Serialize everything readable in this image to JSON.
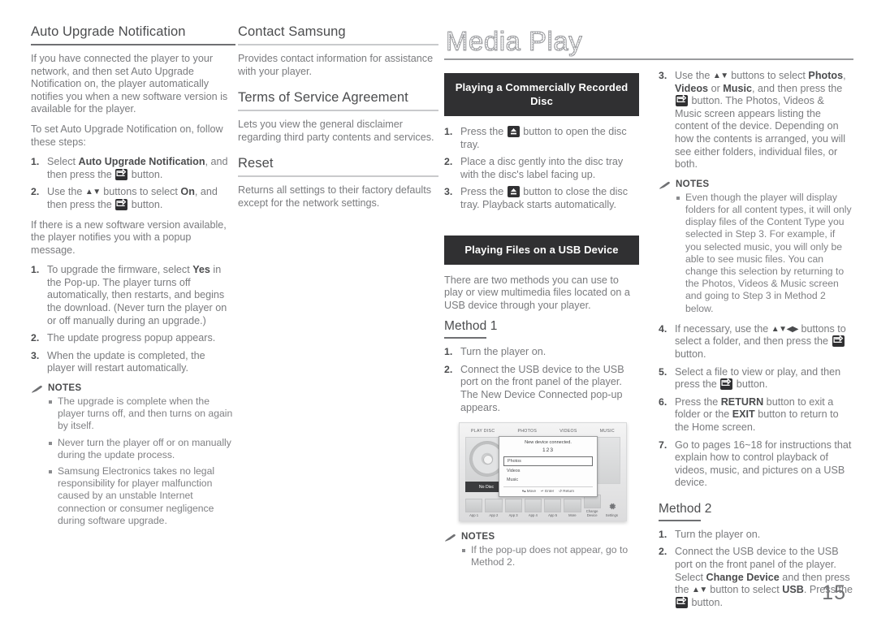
{
  "page": {
    "number": "15",
    "title": "Media Play"
  },
  "column1": {
    "heading": "Auto Upgrade Notification",
    "para1": "If you have connected the player to your network, and then set Auto Upgrade Notification on, the player automatically notifies you when a new software version is available for the player.",
    "para2": "To set Auto Upgrade Notification on, follow these steps:",
    "steps": [
      {
        "num": "1.",
        "html": "Select <b>Auto Upgrade Notification</b>, and then press the §ENTER§ button."
      },
      {
        "num": "2.",
        "html": "Use the §UPDN§ buttons to select <b>On</b>, and then press the §ENTER§ button."
      }
    ],
    "para3": "If there is a new software version available, the player notifies you with a popup message.",
    "steps2": [
      {
        "num": "1.",
        "html": "To upgrade the firmware, select <b>Yes</b> in the Pop-up. The player turns off automatically, then restarts, and begins the download. (Never turn the player on or off manually during an upgrade.)"
      },
      {
        "num": "2.",
        "html": "The update progress popup appears."
      },
      {
        "num": "3.",
        "html": "When the update is completed, the player will restart automatically."
      }
    ],
    "notes_label": "NOTES",
    "notes": [
      "The upgrade is complete when the player turns off, and then turns on again by itself.",
      "Never turn the player off or on manually during the update process.",
      "Samsung Electronics takes no legal responsibility for player malfunction caused by an unstable Internet connection or consumer negligence during software upgrade."
    ]
  },
  "column2": {
    "sections": [
      {
        "heading": "Contact Samsung",
        "body": "Provides contact information for assistance with your player."
      },
      {
        "heading": "Terms of Service Agreement",
        "body": "Lets you view the general disclaimer regarding third party contents and services."
      },
      {
        "heading": "Reset",
        "body": "Returns all settings to their factory defaults except for the network settings."
      }
    ]
  },
  "column3": {
    "banner1": "Playing a Commercially Recorded Disc",
    "steps1": [
      {
        "num": "1.",
        "html": "Press the §EJECT§ button to open the disc tray."
      },
      {
        "num": "2.",
        "html": "Place a disc gently into the disc tray with the disc's label facing up."
      },
      {
        "num": "3.",
        "html": "Press the §EJECT§ button to close the disc tray. Playback starts automatically."
      }
    ],
    "banner2": "Playing Files on a USB Device",
    "intro": "There are two methods you can use to play or view multimedia files located on a USB device through your player.",
    "method1_heading": "Method 1",
    "method1_steps": [
      {
        "num": "1.",
        "html": "Turn the player on."
      },
      {
        "num": "2.",
        "html": "Connect the USB device to the USB port on the front panel of the player. The New Device Connected pop-up appears."
      }
    ],
    "notes_label": "NOTES",
    "notes": [
      "If the pop-up does not appear, go to Method 2."
    ]
  },
  "tv_screen": {
    "tabs": [
      "PLAY DISC",
      "PHOTOS",
      "VIDEOS",
      "MUSIC"
    ],
    "no_disc_label": "No Disc",
    "popup": {
      "title": "New device connected.",
      "device_name": "123",
      "options": [
        "Photos",
        "Videos",
        "Music"
      ],
      "selected_option": "Photos",
      "hints": [
        "Move",
        "Enter",
        "Return"
      ]
    },
    "apps": [
      "App 1",
      "App 2",
      "App 3",
      "App 4",
      "App 5",
      "More"
    ],
    "change_device_label": "Change Device",
    "settings_label": "Settings"
  },
  "column4": {
    "steps_top": [
      {
        "num": "3.",
        "html": "Use the §UPDN§ buttons to select <b>Photos</b>, <b>Videos</b> or <b>Music</b>, and then press the §ENTER§ button. The Photos, Videos &amp; Music screen appears listing the content of the device. Depending on how the contents is arranged, you will see either folders, individual files, or both."
      }
    ],
    "notes_label": "NOTES",
    "notes": [
      "Even though the player will display folders for all content types, it will only display files of the Content Type you selected in Step 3. For example, if you selected music, you will only be able to see music files. You can change this selection by returning to the Photos, Videos & Music screen and going to Step 3 in Method 2 below."
    ],
    "steps_bottom": [
      {
        "num": "4.",
        "html": "If necessary, use the §UDLR§ buttons to select a folder, and then press the §ENTER§ button."
      },
      {
        "num": "5.",
        "html": "Select a file to view or play, and then press the §ENTER§ button."
      },
      {
        "num": "6.",
        "html": "Press the <b>RETURN</b> button to exit a folder or the <b>EXIT</b> button to return to the Home screen."
      },
      {
        "num": "7.",
        "html": "Go to pages 16~18 for instructions that explain how to control playback of videos, music, and pictures on a USB device."
      }
    ],
    "method2_heading": "Method 2",
    "method2_steps": [
      {
        "num": "1.",
        "html": "Turn the player on."
      },
      {
        "num": "2.",
        "html": "Connect the USB device to the USB port on the front panel of the player. Select <b>Change Device</b> and then press the §UPDN§ button to select <b>USB</b>. Press the §ENTER§ button."
      }
    ]
  }
}
